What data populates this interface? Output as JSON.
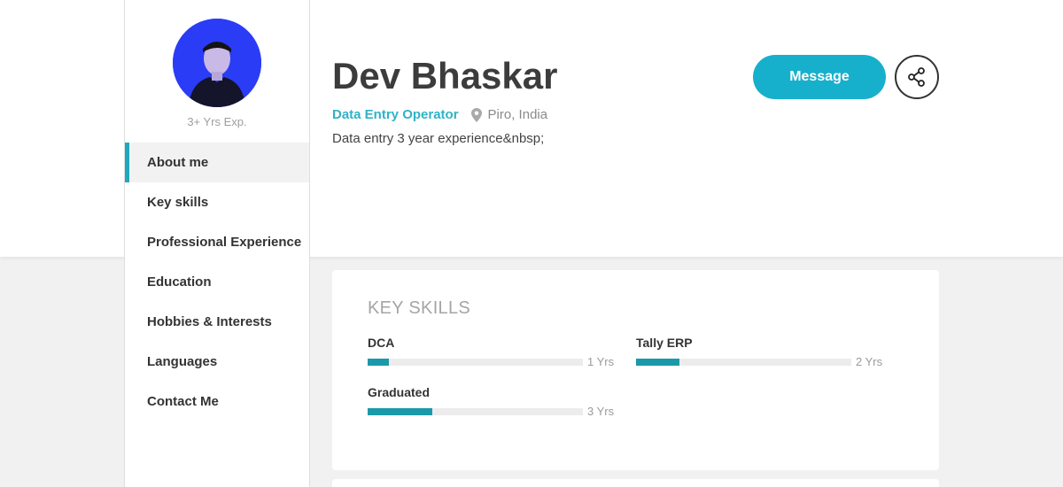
{
  "profile": {
    "name": "Dev Bhaskar",
    "job_title": "Data Entry Operator",
    "location": "Piro, India",
    "bio": "Data entry 3 year experience&nbsp;",
    "experience": "3+ Yrs Exp."
  },
  "actions": {
    "message_label": "Message"
  },
  "sidebar": {
    "items": [
      {
        "label": "About me",
        "active": true
      },
      {
        "label": "Key skills"
      },
      {
        "label": "Professional Experience"
      },
      {
        "label": "Education"
      },
      {
        "label": "Hobbies & Interests"
      },
      {
        "label": "Languages"
      },
      {
        "label": "Contact Me"
      }
    ]
  },
  "key_skills": {
    "title": "KEY SKILLS",
    "skills": [
      {
        "name": "DCA",
        "years": "1 Yrs",
        "level": 0.1
      },
      {
        "name": "Tally ERP",
        "years": "2 Yrs",
        "level": 0.2
      },
      {
        "name": "Graduated",
        "years": "3 Yrs",
        "level": 0.3
      }
    ]
  },
  "colors": {
    "accent": "#20a9bd",
    "message_button": "#17b0cc",
    "skill_bar": "#1a9aa8"
  },
  "icons": {
    "location": "map-pin-icon",
    "share": "share-icon"
  }
}
